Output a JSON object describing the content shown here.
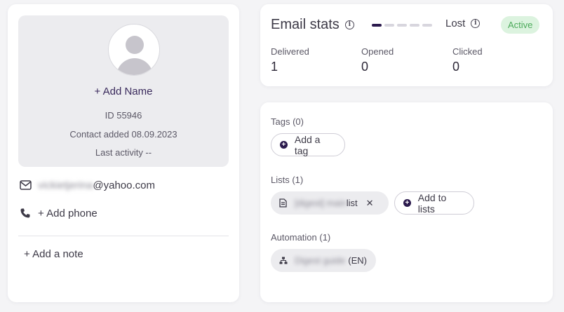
{
  "profile": {
    "add_name": "+ Add Name",
    "id_line": "ID 55946",
    "added_line": "Contact added 08.09.2023",
    "activity_line": "Last activity --"
  },
  "contact": {
    "email_hidden": "vickietjerina",
    "email_domain": "@yahoo.com",
    "add_phone": "+ Add phone",
    "add_note": "+ Add a note"
  },
  "stats": {
    "title": "Email stats",
    "lost_label": "Lost",
    "status_badge": "Active",
    "delivered_label": "Delivered",
    "delivered_value": "1",
    "opened_label": "Opened",
    "opened_value": "0",
    "clicked_label": "Clicked",
    "clicked_value": "0",
    "progress_filled": 1,
    "progress_total": 5
  },
  "tags": {
    "label": "Tags (0)",
    "add_button": "Add a tag"
  },
  "lists": {
    "label": "Lists (1)",
    "item_hidden": "[digest] main",
    "item_visible": "list",
    "add_button": "Add to lists"
  },
  "automation": {
    "label": "Automation (1)",
    "item_hidden": "Digest guide",
    "item_visible": "(EN)"
  },
  "colors": {
    "accent": "#2b1a4d",
    "badge_bg": "#dcf3df",
    "badge_text": "#4caa5a"
  }
}
